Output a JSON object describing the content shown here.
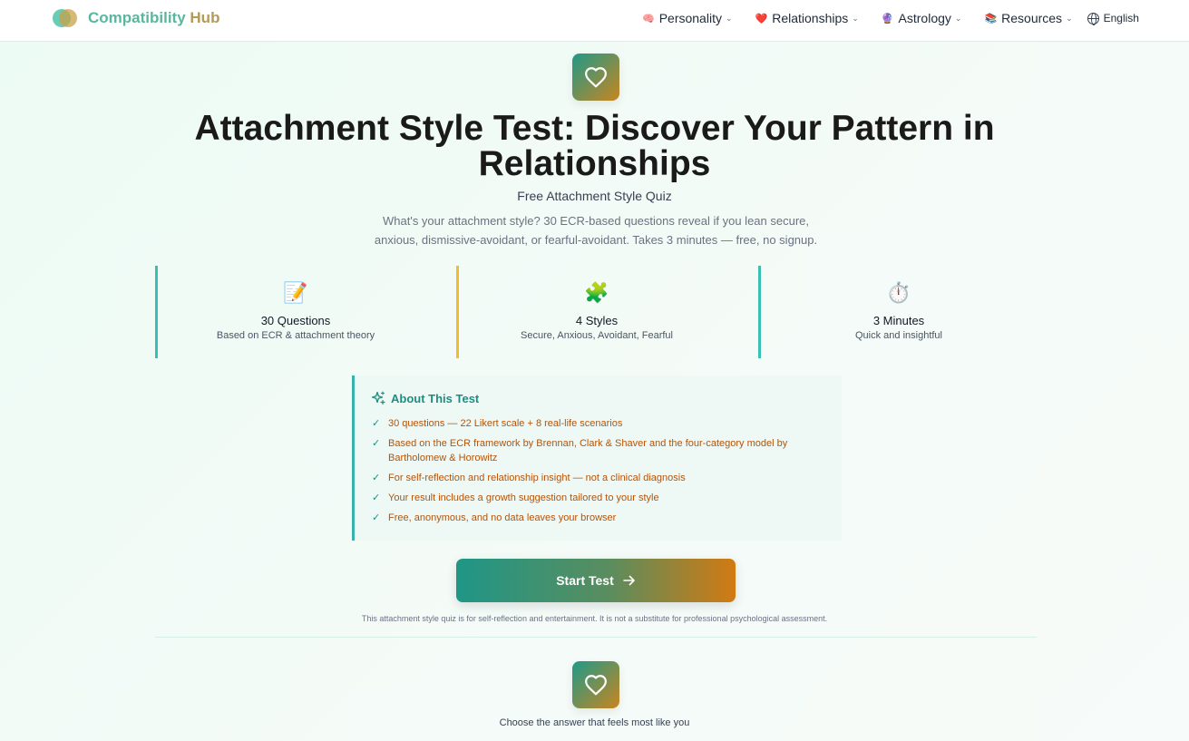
{
  "brand": {
    "part1": "Compatibility",
    "part2": "Hub",
    "color_primary": "#5bb69e",
    "color_secondary": "#b49a5a"
  },
  "nav": {
    "items": [
      {
        "label": "Personality",
        "icon": "brain-emoji",
        "glyph": "🧠"
      },
      {
        "label": "Relationships",
        "icon": "heart-emoji",
        "glyph": "❤️"
      },
      {
        "label": "Astrology",
        "icon": "crystal-ball-emoji",
        "glyph": "🔮"
      },
      {
        "label": "Resources",
        "icon": "books-emoji",
        "glyph": "📚"
      }
    ],
    "language": "English"
  },
  "hero": {
    "title": "Attachment Style Test: Discover Your Pattern in Relationships",
    "subtitle": "Free Attachment Style Quiz",
    "description": "What's your attachment style? 30 ECR-based questions reveal if you lean secure, anxious, dismissive-avoidant, or fearful-avoidant. Takes 3 minutes — free, no signup."
  },
  "stats": [
    {
      "icon": "memo-emoji",
      "glyph": "📝",
      "title": "30 Questions",
      "subtitle": "Based on ECR & attachment theory",
      "accent": "#38c0b4"
    },
    {
      "icon": "puzzle-emoji",
      "glyph": "🧩",
      "title": "4 Styles",
      "subtitle": "Secure, Anxious, Avoidant, Fearful",
      "accent": "#f1bd2a"
    },
    {
      "icon": "stopwatch-emoji",
      "glyph": "⏱️",
      "title": "3 Minutes",
      "subtitle": "Quick and insightful",
      "accent": "#38c0b4"
    }
  ],
  "about": {
    "title": "About This Test",
    "items": [
      "30 questions — 22 Likert scale + 8 real-life scenarios",
      "Based on the ECR framework by Brennan, Clark & Shaver and the four-category model by Bartholomew & Horowitz",
      "For self-reflection and relationship insight — not a clinical diagnosis",
      "Your result includes a growth suggestion tailored to your style",
      "Free, anonymous, and no data leaves your browser"
    ]
  },
  "start_button": {
    "label": "Start Test"
  },
  "disclaimer": "This attachment style quiz is for self-reflection and entertainment. It is not a substitute for professional psychological assessment.",
  "question_prompt": "Choose the answer that feels most like you",
  "colors": {
    "teal": "#1f9a88",
    "amber": "#c9851f",
    "list_text": "#b45309"
  }
}
